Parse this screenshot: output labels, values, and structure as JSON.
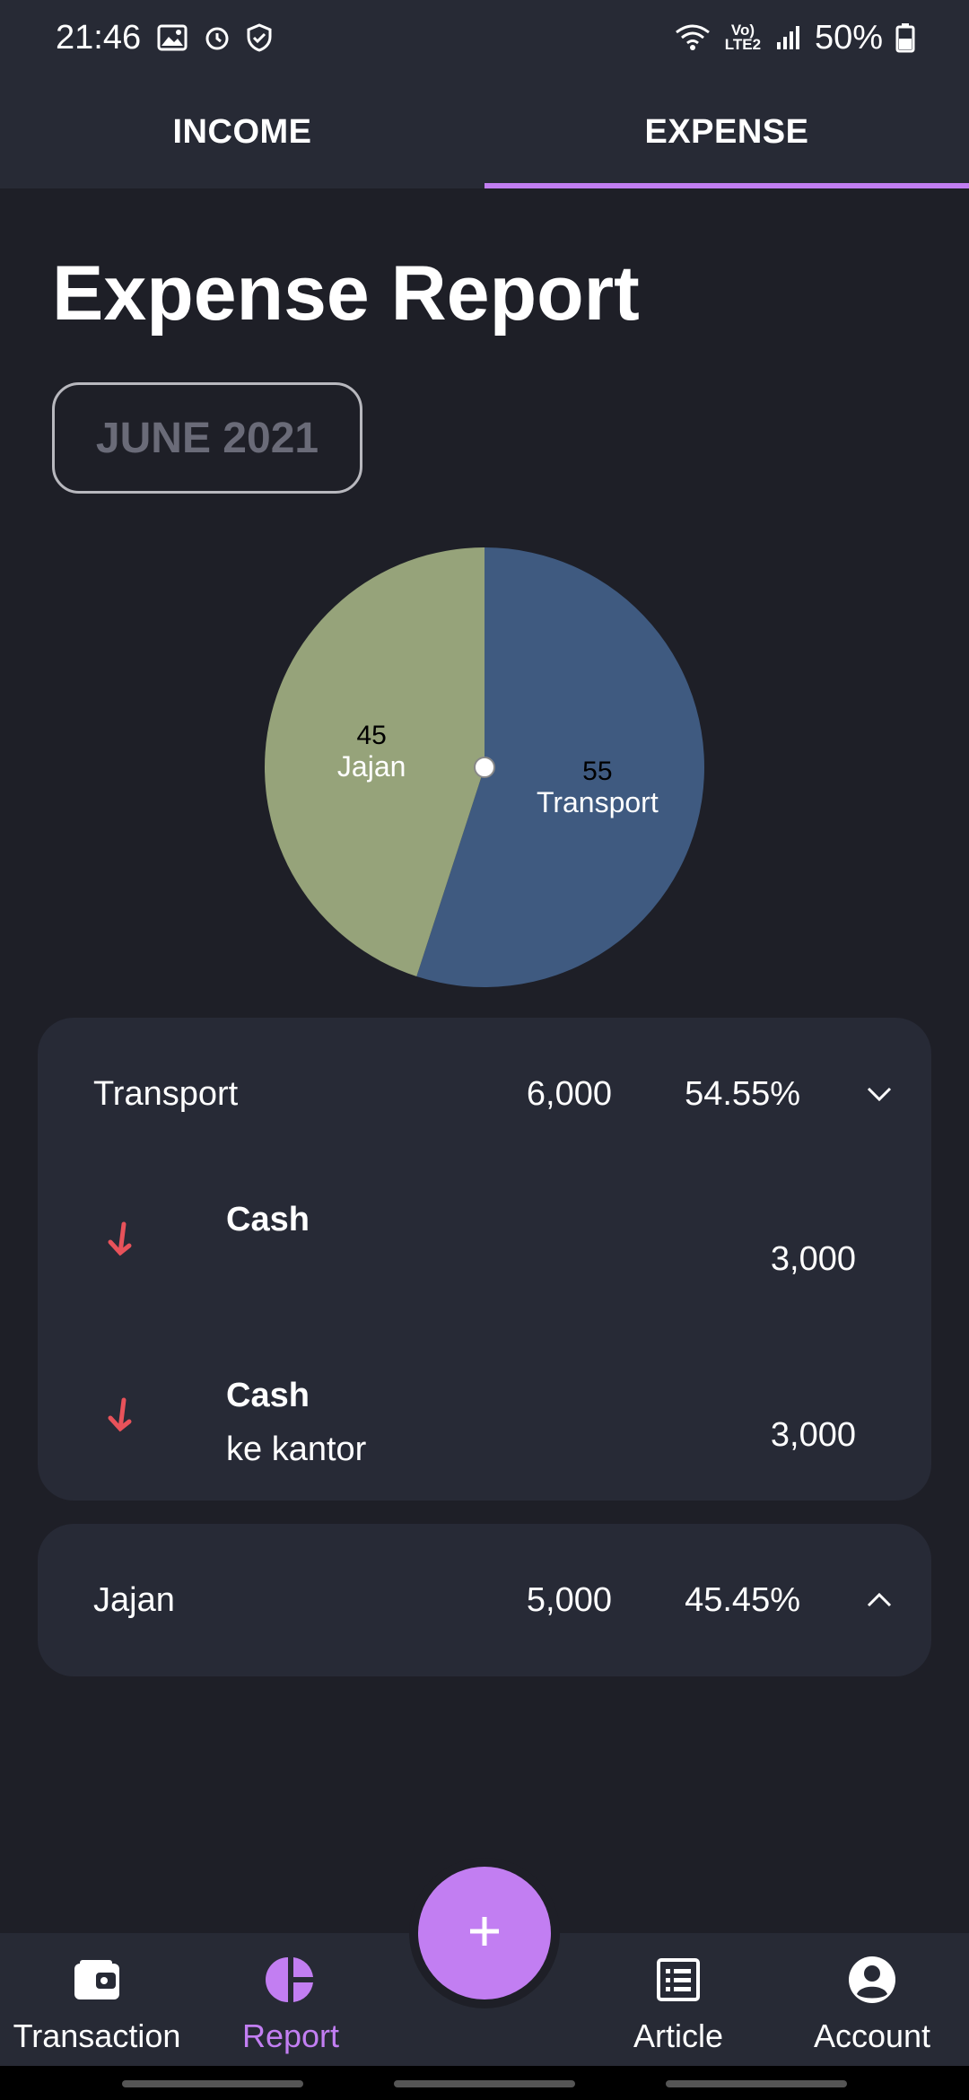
{
  "status_bar": {
    "time": "21:46",
    "network_label": "Vo) LTE2",
    "battery": "50%"
  },
  "tabs": [
    {
      "label": "INCOME",
      "active": false
    },
    {
      "label": "EXPENSE",
      "active": true
    }
  ],
  "page": {
    "title": "Expense Report",
    "month": "JUNE 2021"
  },
  "chart_data": {
    "type": "pie",
    "slices": [
      {
        "label": "Transport",
        "value": 55,
        "color": "#3f5a80"
      },
      {
        "label": "Jajan",
        "value": 45,
        "color": "#96a37a"
      }
    ]
  },
  "categories": [
    {
      "name": "Transport",
      "amount": "6,000",
      "percent": "54.55%",
      "expanded": true,
      "transactions": [
        {
          "title": "Cash",
          "note": "",
          "amount": "3,000",
          "icon": "arrow-down-icon"
        },
        {
          "title": "Cash",
          "note": "ke kantor",
          "amount": "3,000",
          "icon": "arrow-down-icon"
        }
      ]
    },
    {
      "name": "Jajan",
      "amount": "5,000",
      "percent": "45.45%",
      "expanded": false,
      "transactions": []
    }
  ],
  "bottom_nav": [
    {
      "label": "Transaction",
      "icon": "wallet-icon",
      "active": false
    },
    {
      "label": "Report",
      "icon": "pie-chart-icon",
      "active": true
    },
    {
      "label": "Article",
      "icon": "article-icon",
      "active": false
    },
    {
      "label": "Account",
      "icon": "account-icon",
      "active": false
    }
  ],
  "fab": {
    "icon": "plus-icon"
  },
  "colors": {
    "accent": "#c27ef2",
    "expense_arrow": "#e8525a",
    "background": "#1e1f27",
    "surface": "#272a36"
  }
}
